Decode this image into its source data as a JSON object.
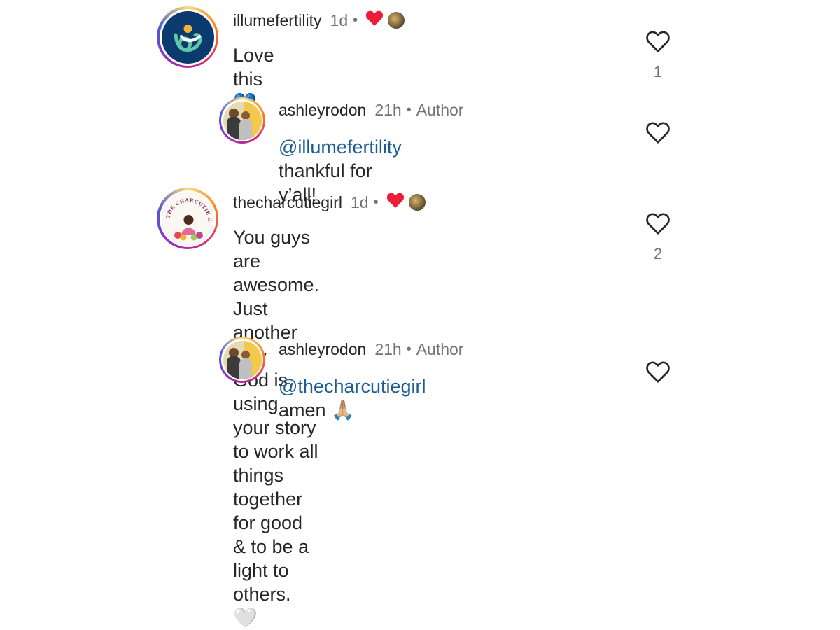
{
  "comments": [
    {
      "username": "illumefertility",
      "time": "1d",
      "text": "Love this 💙💙",
      "likes": "1"
    },
    {
      "username": "ashleyrodon",
      "time": "21h",
      "author_label": "Author",
      "mention": "@illumefertility",
      "text": "thankful for y’all!"
    },
    {
      "username": "thecharcutiegirl",
      "time": "1d",
      "text_lines": [
        "You guys are awesome. Just another way",
        "God is using your story to work all things",
        "together for good & to be a light to others."
      ],
      "white_heart": "🤍",
      "likes": "2",
      "avatar_badge_text": "THE CHARCUTIE GIRL"
    },
    {
      "username": "ashleyrodon",
      "time": "21h",
      "author_label": "Author",
      "mention": "@thecharcutiegirl",
      "text": "amen",
      "emoji": "🙏🏼"
    }
  ],
  "separator": "•",
  "icons": {
    "like": "heart-outline-icon",
    "creator_liked": "red-heart-icon"
  },
  "colors": {
    "mention": "#1d5c96",
    "muted": "#737373",
    "liked_red": "#ed1c3a",
    "illume_blue": "#0b3a6e"
  }
}
